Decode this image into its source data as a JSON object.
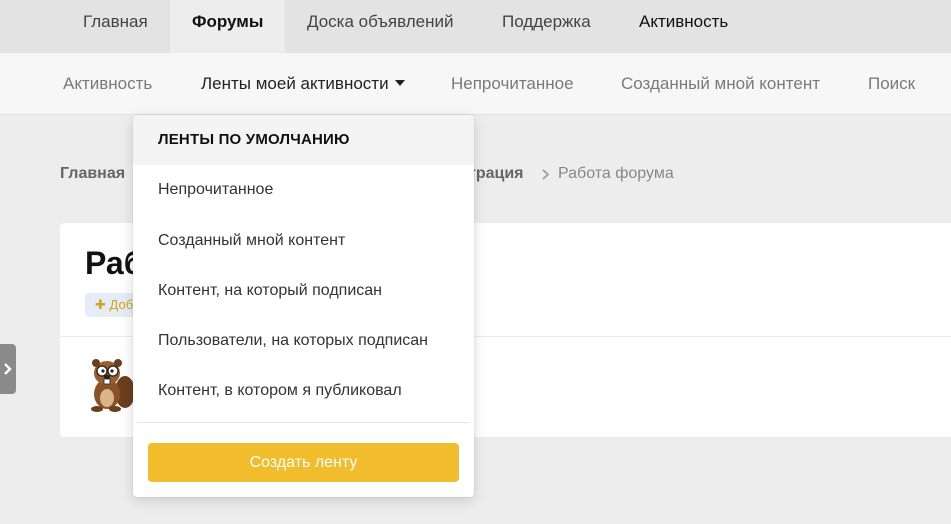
{
  "topnav": {
    "items": [
      {
        "label": "Главная"
      },
      {
        "label": "Форумы"
      },
      {
        "label": "Доска объявлений"
      },
      {
        "label": "Поддержка"
      },
      {
        "label": "Активность"
      }
    ]
  },
  "subnav": {
    "items": [
      {
        "label": "Активность"
      },
      {
        "label": "Ленты моей активности"
      },
      {
        "label": "Непрочитанное"
      },
      {
        "label": "Созданный мной контент"
      },
      {
        "label": "Поиск"
      }
    ]
  },
  "breadcrumb": {
    "home": "Главная",
    "partial": "трация",
    "current": "Работа форума"
  },
  "card": {
    "title_partial": "Раб",
    "add_partial": "Доб"
  },
  "dropdown": {
    "header": "ЛЕНТЫ ПО УМОЛЧАНИЮ",
    "items": [
      {
        "label": "Непрочитанное"
      },
      {
        "label": "Созданный мной контент"
      },
      {
        "label": "Контент, на который подписан"
      },
      {
        "label": "Пользователи, на которых подписан"
      },
      {
        "label": "Контент, в котором я публиковал"
      }
    ],
    "create_button": "Создать ленту"
  },
  "colors": {
    "accent_button": "#f2bd2d",
    "add_plus": "#d8a21b"
  }
}
